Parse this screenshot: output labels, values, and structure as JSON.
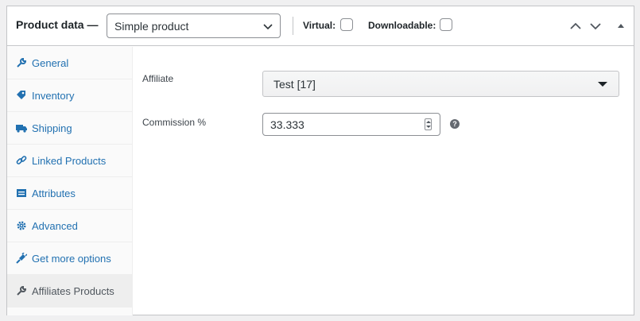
{
  "header": {
    "title": "Product data —",
    "product_type": "Simple product",
    "virtual_label": "Virtual:",
    "downloadable_label": "Downloadable:"
  },
  "tabs": [
    {
      "label": "General",
      "icon": "wrench-icon"
    },
    {
      "label": "Inventory",
      "icon": "tag-icon"
    },
    {
      "label": "Shipping",
      "icon": "truck-icon"
    },
    {
      "label": "Linked Products",
      "icon": "link-icon"
    },
    {
      "label": "Attributes",
      "icon": "list-icon"
    },
    {
      "label": "Advanced",
      "icon": "gear-icon"
    },
    {
      "label": "Get more options",
      "icon": "plug-icon"
    },
    {
      "label": "Affiliates Products",
      "icon": "wrench-icon"
    }
  ],
  "active_tab": 7,
  "fields": {
    "affiliate_label": "Affiliate",
    "affiliate_value": "Test [17]",
    "commission_label": "Commission %",
    "commission_value": "33.333",
    "help_glyph": "?"
  },
  "colors": {
    "link": "#2271b1",
    "active_tab_bg": "#eeeeee",
    "border": "#c3c4c7"
  }
}
